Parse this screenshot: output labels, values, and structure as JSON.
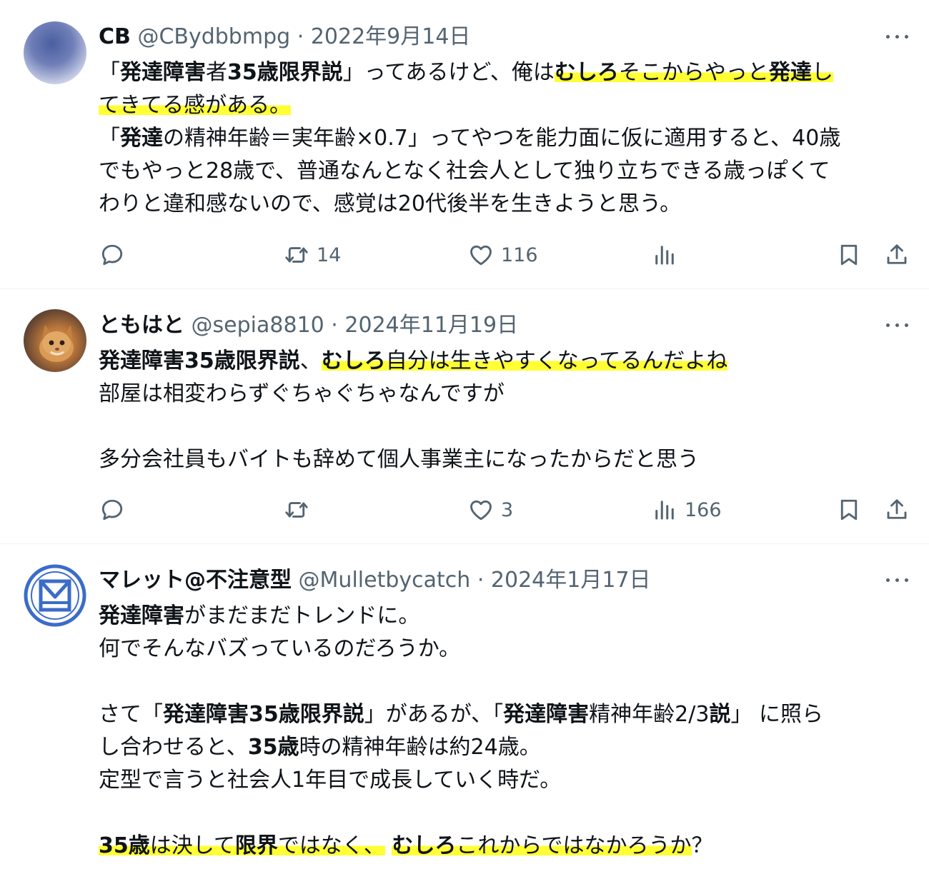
{
  "colors": {
    "highlight": "#ffff33",
    "meta": "#536471",
    "text": "#0f1419",
    "avatar_blue": "#3b6cc9"
  },
  "tweets": [
    {
      "name": "CB",
      "handle": "@CBydbbmpg",
      "dot": "·",
      "date": "2022年9月14日",
      "lines": [
        [
          {
            "t": "「"
          },
          {
            "t": "発達障害",
            "b": true
          },
          {
            "t": "者"
          },
          {
            "t": "35歳限界説",
            "b": true
          },
          {
            "t": "」ってあるけど、俺は"
          },
          {
            "t": "むしろ",
            "b": true,
            "h": true
          },
          {
            "t": "そこからやっと",
            "h": true
          },
          {
            "t": "発達",
            "b": true,
            "h": true
          },
          {
            "t": "し",
            "h": true
          }
        ],
        [
          {
            "t": "てきてる感がある。",
            "h": true
          }
        ],
        [
          {
            "t": "「"
          },
          {
            "t": "発達",
            "b": true
          },
          {
            "t": "の精神年齢＝実年齢×0.7」ってやつを能力面に仮に適用すると、40歳"
          }
        ],
        [
          {
            "t": "でもやっと28歳で、普通なんとなく社会人として独り立ちできる歳っぽくて"
          }
        ],
        [
          {
            "t": "わりと違和感ないので、感覚は20代後半を生きようと思う。"
          }
        ]
      ],
      "counts": {
        "reply": "",
        "retweet": "14",
        "like": "116",
        "views": ""
      }
    },
    {
      "name": "ともはと",
      "handle": "@sepia8810",
      "dot": "·",
      "date": "2024年11月19日",
      "lines": [
        [
          {
            "t": "発達障害35歳限界説",
            "b": true
          },
          {
            "t": "、"
          },
          {
            "t": "むしろ",
            "b": true,
            "h": true
          },
          {
            "t": "自分は生きやすくなってるんだよね",
            "h": true
          }
        ],
        [
          {
            "t": "部屋は相変わらずぐちゃぐちゃなんですが"
          }
        ],
        [],
        [
          {
            "t": "多分会社員もバイトも辞めて個人事業主になったからだと思う"
          }
        ]
      ],
      "counts": {
        "reply": "",
        "retweet": "",
        "like": "3",
        "views": "166"
      }
    },
    {
      "name": "マレット@不注意型",
      "handle": "@Mulletbycatch",
      "dot": "·",
      "date": "2024年1月17日",
      "lines": [
        [
          {
            "t": "発達障害",
            "b": true
          },
          {
            "t": "がまだまだトレンドに。"
          }
        ],
        [
          {
            "t": "何でそんなバズっているのだろうか。"
          }
        ],
        [],
        [
          {
            "t": "さて「"
          },
          {
            "t": "発達障害35歳限界説",
            "b": true
          },
          {
            "t": "」があるが、「"
          },
          {
            "t": "発達障害",
            "b": true
          },
          {
            "t": "精神年齢2/3"
          },
          {
            "t": "説",
            "b": true
          },
          {
            "t": "」 に照ら"
          }
        ],
        [
          {
            "t": "し合わせると、"
          },
          {
            "t": "35歳",
            "b": true
          },
          {
            "t": "時の精神年齢は約24歳。"
          }
        ],
        [
          {
            "t": "定型で言うと社会人1年目で成長していく時だ。"
          }
        ],
        [],
        [
          {
            "t": "35歳",
            "b": true,
            "h": true
          },
          {
            "t": "は決して",
            "h": true
          },
          {
            "t": "限界",
            "b": true,
            "h": true
          },
          {
            "t": "ではなく、",
            "h": true
          },
          {
            "t": " "
          },
          {
            "t": "むしろ",
            "b": true,
            "h": true
          },
          {
            "t": "これからではなかろうか",
            "h": true
          },
          {
            "t": "？"
          }
        ]
      ]
    }
  ],
  "icons": [
    "reply-icon",
    "retweet-icon",
    "like-icon",
    "views-icon",
    "bookmark-icon",
    "share-icon",
    "more-icon"
  ]
}
